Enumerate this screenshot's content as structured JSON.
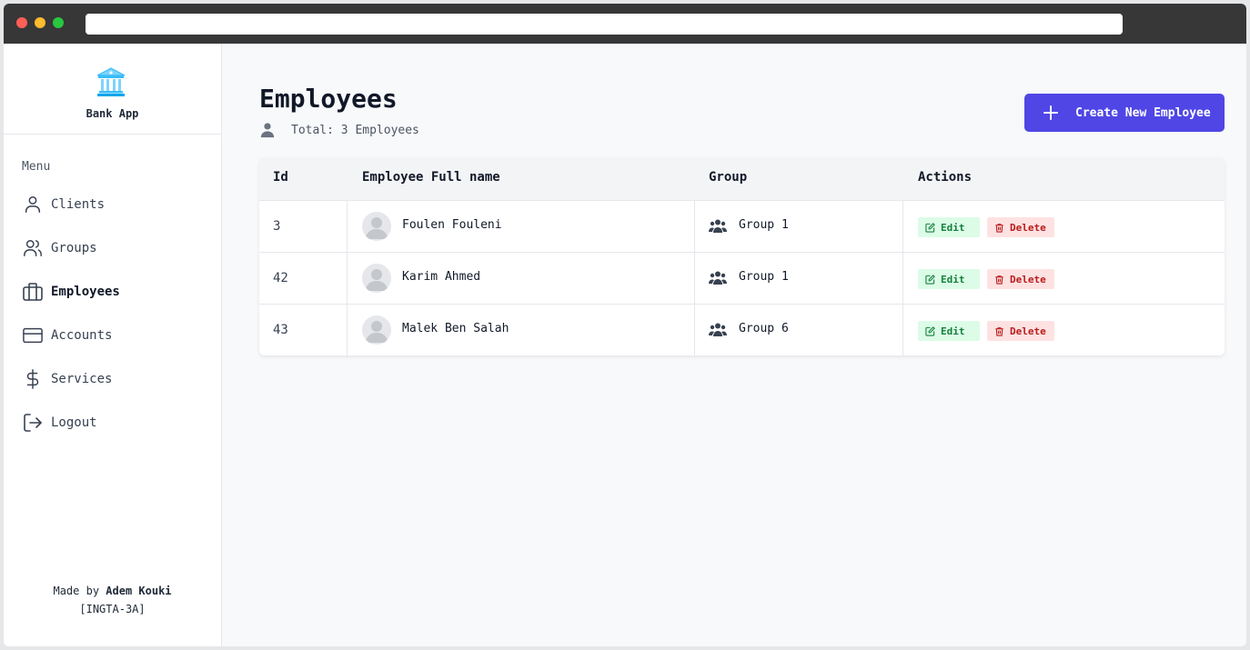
{
  "app": {
    "name": "Bank App",
    "brand_icon": "bank-icon",
    "accent_color": "#4f46e5"
  },
  "sidebar": {
    "menu_title": "Menu",
    "items": [
      {
        "label": "Clients",
        "icon": "user-icon",
        "active": false
      },
      {
        "label": "Groups",
        "icon": "users-icon",
        "active": false
      },
      {
        "label": "Employees",
        "icon": "briefcase-icon",
        "active": true
      },
      {
        "label": "Accounts",
        "icon": "credit-card-icon",
        "active": false
      },
      {
        "label": "Services",
        "icon": "dollar-icon",
        "active": false
      },
      {
        "label": "Logout",
        "icon": "logout-icon",
        "active": false
      }
    ],
    "footer": {
      "made_by": "Made by",
      "author": "Adem Kouki",
      "class": "[INGTA-3A]"
    }
  },
  "main": {
    "title": "Employees",
    "total_text": "Total: 3 Employees",
    "create_button": "Create New Employee",
    "table": {
      "headers": [
        "Id",
        "Employee Full name",
        "Group",
        "Actions"
      ],
      "rows": [
        {
          "id": "3",
          "name": "Foulen Fouleni",
          "group": "Group 1"
        },
        {
          "id": "42",
          "name": "Karim Ahmed",
          "group": "Group 1"
        },
        {
          "id": "43",
          "name": "Malek Ben Salah",
          "group": "Group 6"
        }
      ],
      "edit_label": "Edit",
      "delete_label": "Delete"
    }
  }
}
